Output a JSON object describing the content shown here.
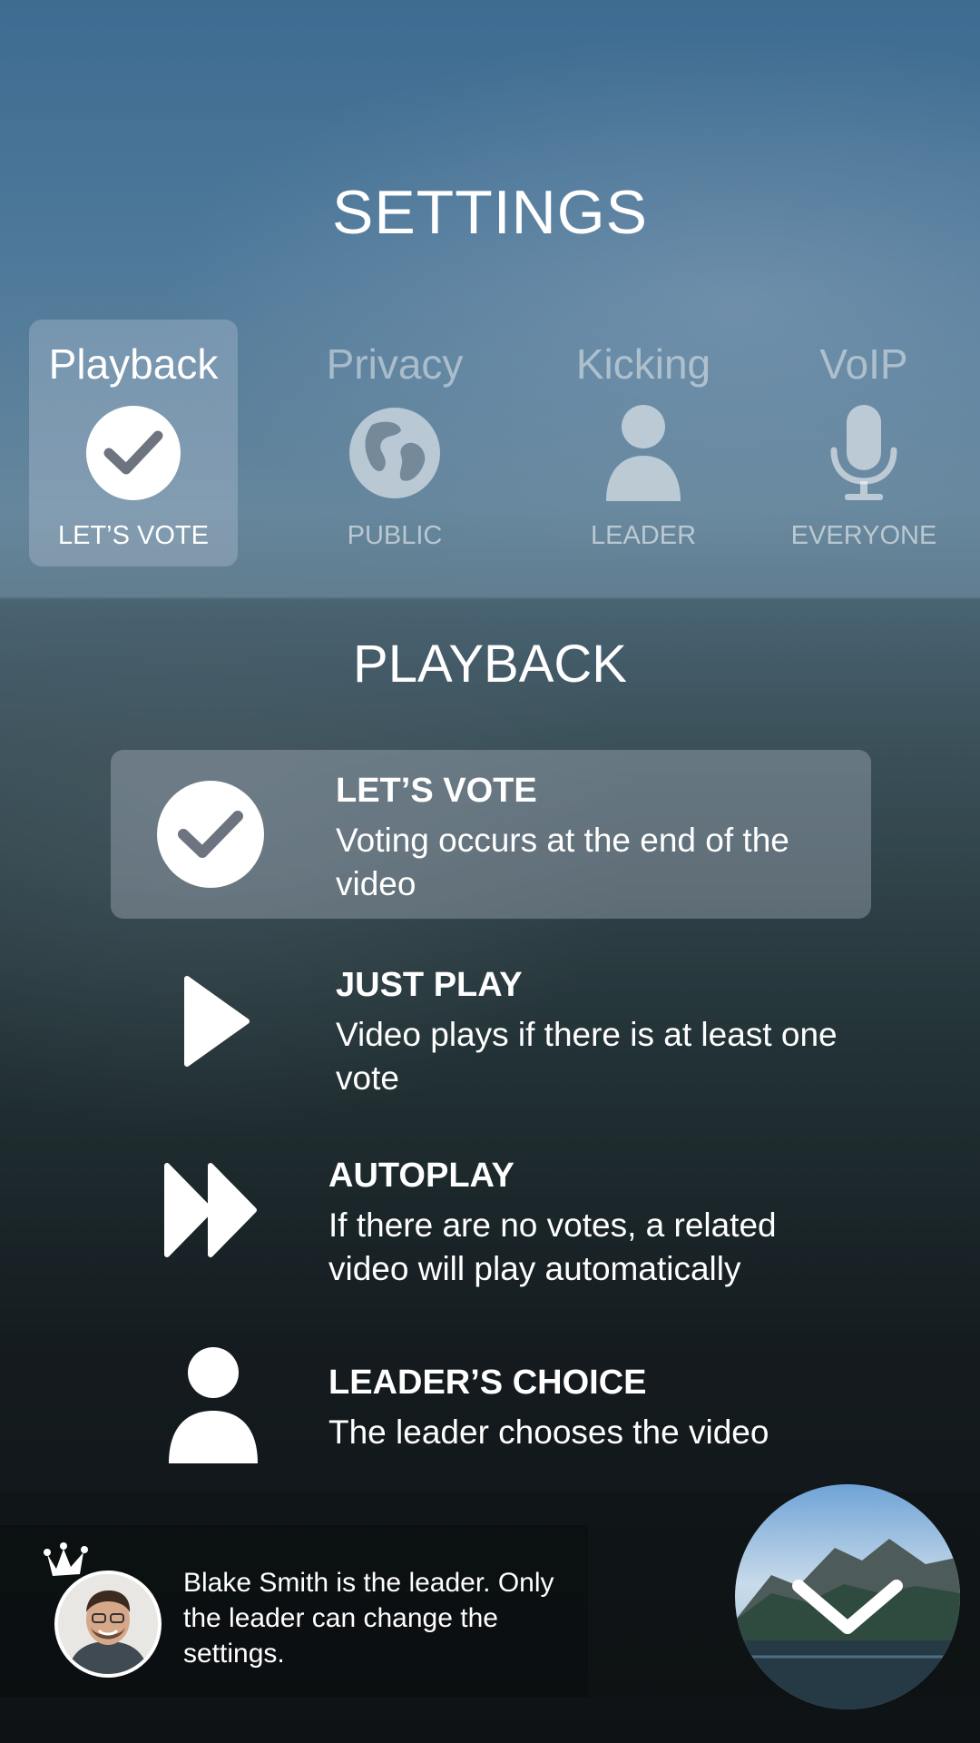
{
  "header": {
    "title": "SETTINGS"
  },
  "tabs": [
    {
      "label": "Playback",
      "value": "LET’S VOTE",
      "icon": "check-circle-icon",
      "active": true
    },
    {
      "label": "Privacy",
      "value": "PUBLIC",
      "icon": "globe-icon",
      "active": false
    },
    {
      "label": "Kicking",
      "value": "LEADER",
      "icon": "person-icon",
      "active": false
    },
    {
      "label": "VoIP",
      "value": "EVERYONE",
      "icon": "microphone-icon",
      "active": false
    }
  ],
  "playback": {
    "title": "PLAYBACK",
    "options": [
      {
        "name": "LET’S VOTE",
        "description": "Voting occurs at the end of the video",
        "icon": "check-circle-icon",
        "selected": true
      },
      {
        "name": "JUST PLAY",
        "description": "Video plays if there is at least one vote",
        "icon": "play-icon",
        "selected": false
      },
      {
        "name": "AUTOPLAY",
        "description": "If there are no votes, a related video will play automatically",
        "icon": "fast-forward-icon",
        "selected": false
      },
      {
        "name": "LEADER’S CHOICE",
        "description": "The leader chooses the video",
        "icon": "person-icon",
        "selected": false
      }
    ]
  },
  "footer": {
    "leader_message": "Blake Smith is the leader. Only the leader can change the settings.",
    "collapse_icon": "chevron-down-icon"
  },
  "colors": {
    "accent_text": "#ffffff",
    "inactive_text": "rgba(255,255,255,0.5)"
  }
}
